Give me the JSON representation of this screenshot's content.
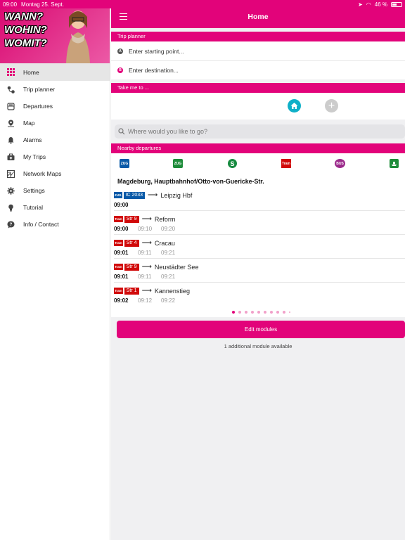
{
  "status": {
    "time": "09:00",
    "date": "Montag 25. Sept.",
    "battery": "46 %"
  },
  "banner": {
    "lines": [
      "WANN?",
      "WOHIN?",
      "WOMIT?"
    ]
  },
  "sidebar": {
    "items": [
      {
        "label": "Home",
        "icon": "grid-icon"
      },
      {
        "label": "Trip planner",
        "icon": "route-icon"
      },
      {
        "label": "Departures",
        "icon": "departures-icon"
      },
      {
        "label": "Map",
        "icon": "map-pin-icon"
      },
      {
        "label": "Alarms",
        "icon": "bell-icon"
      },
      {
        "label": "My Trips",
        "icon": "briefcase-icon"
      },
      {
        "label": "Network Maps",
        "icon": "network-map-icon"
      },
      {
        "label": "Settings",
        "icon": "gear-icon"
      },
      {
        "label": "Tutorial",
        "icon": "lightbulb-icon"
      },
      {
        "label": "Info / Contact",
        "icon": "help-icon"
      }
    ]
  },
  "header": {
    "title": "Home"
  },
  "trip_planner": {
    "title": "Trip planner",
    "start_marker": "A",
    "start_placeholder": "Enter starting point...",
    "dest_marker": "B",
    "dest_placeholder": "Enter destination..."
  },
  "take_me": {
    "title": "Take me to ..."
  },
  "search": {
    "placeholder": "Where would you like to go?"
  },
  "nearby": {
    "title": "Nearby departures",
    "modes": [
      "ZUG",
      "ZUG",
      "S",
      "Tram",
      "BUS",
      "ferry"
    ],
    "stop": "Magdeburg, Hauptbahnhof/Otto-von-Guericke-Str.",
    "departures": [
      {
        "type": "ZUG",
        "line": "IC 2033",
        "destination": "Leipzig Hbf",
        "times": [
          "09:00"
        ]
      },
      {
        "type": "Tram",
        "line": "Str 9",
        "destination": "Reform",
        "times": [
          "09:00",
          "09:10",
          "09:20"
        ]
      },
      {
        "type": "Tram",
        "line": "Str 4",
        "destination": "Cracau",
        "times": [
          "09:01",
          "09:11",
          "09:21"
        ]
      },
      {
        "type": "Tram",
        "line": "Str 9",
        "destination": "Neustädter See",
        "times": [
          "09:01",
          "09:11",
          "09:21"
        ]
      },
      {
        "type": "Tram",
        "line": "Str 1",
        "destination": "Kannenstieg",
        "times": [
          "09:02",
          "09:12",
          "09:22"
        ]
      }
    ]
  },
  "footer": {
    "edit_label": "Edit modules",
    "info": "1 additional module available"
  },
  "colors": {
    "brand": "#e2037a",
    "home_fav": "#0fb0c8",
    "tram": "#d10a0a",
    "zug": "#0a5aa8"
  }
}
